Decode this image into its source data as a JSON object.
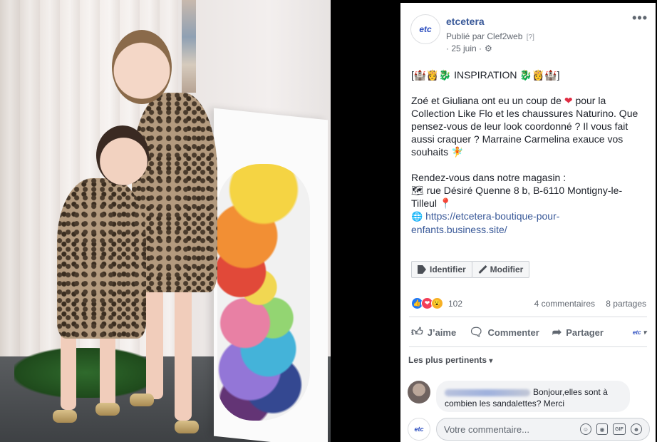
{
  "post": {
    "page_name": "etcetera",
    "avatar_text": "etc",
    "published_by": "Publié par Clef2web",
    "published_help": "[?]",
    "date": "· 25 juin ·",
    "more": "•••",
    "text": {
      "title_line": "[🏰👸🐉 INSPIRATION 🐉👸🏰]",
      "para1_a": "Zoé et Giuliana ont eu un coup de ",
      "para1_heart": "❤",
      "para1_b": " pour la Collection Like Flo et les chaussures Naturino. Que pensez-vous de leur look coordonné ? Il vous fait aussi craquer ? Marraine Carmelina exauce vos souhaits ",
      "para1_fairy": "🧚",
      "para2_intro": "Rendez-vous dans notre magasin :",
      "address": "🗺 rue Désiré Quenne 8 b, B-6110 Montigny-le-Tilleul 📍",
      "globe": "🌐",
      "link": "https://etcetera-boutique-pour-enfants.business.site/"
    },
    "buttons": {
      "tag": "Identifier",
      "edit": "Modifier"
    },
    "reactions": {
      "count": "102",
      "comments": "4 commentaires",
      "shares": "8 partages"
    },
    "actions": {
      "like": "J’aime",
      "comment": "Commenter",
      "share": "Partager"
    },
    "sort_label": "Les plus pertinents",
    "comment": {
      "text": "Bonjour,elles sont à combien les sandalettes? Merci"
    },
    "composer": {
      "placeholder": "Votre commentaire..."
    }
  },
  "colors": {
    "link": "#385898",
    "like_blue": "#2078f4",
    "love_red": "#f33e58",
    "wow_yellow": "#f7b125"
  }
}
